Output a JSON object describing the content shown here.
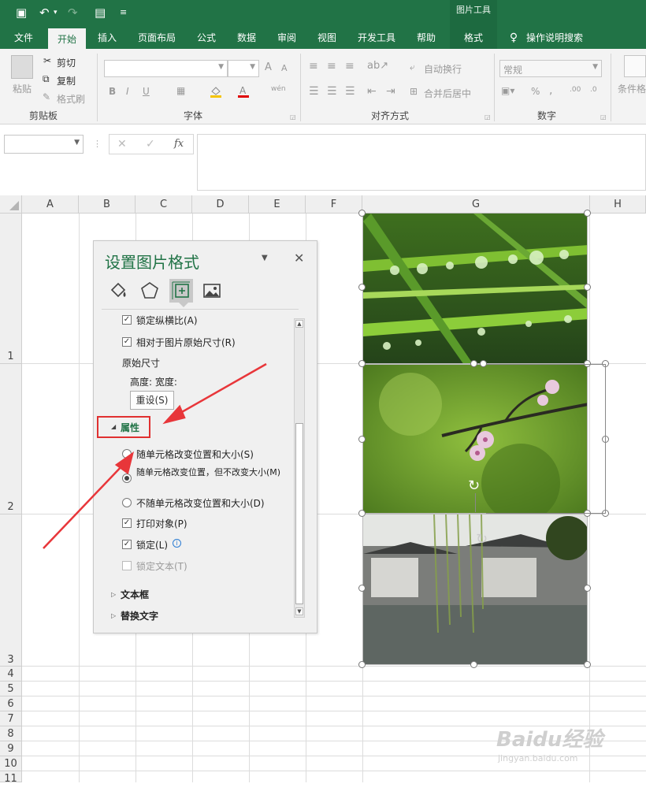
{
  "quick_access": {
    "save_icon": "save-icon",
    "undo_icon": "undo-icon",
    "redo_icon": "redo-icon",
    "form_icon": "form-icon",
    "customize_icon": "customize-icon"
  },
  "contextual_title": "图片工具",
  "tabs": [
    "文件",
    "开始",
    "插入",
    "页面布局",
    "公式",
    "数据",
    "审阅",
    "视图",
    "开发工具",
    "帮助",
    "格式"
  ],
  "tell_me": "操作说明搜索",
  "ribbon": {
    "clipboard": {
      "paste": "粘贴",
      "cut": "剪切",
      "copy": "复制",
      "format_painter": "格式刷",
      "label": "剪贴板"
    },
    "font": {
      "label": "字体",
      "bold": "B",
      "italic": "I",
      "underline": "U",
      "grow": "A",
      "shrink": "A",
      "wen": "wén"
    },
    "alignment": {
      "wrap": "自动换行",
      "merge": "合并后居中",
      "label": "对齐方式"
    },
    "number": {
      "format": "常规",
      "percent": "%",
      "comma": ",",
      "label": "数字"
    },
    "styles": {
      "conditional": "条件格"
    }
  },
  "formula_bar": {
    "fx": "fx",
    "cancel": "✕",
    "enter": "✓"
  },
  "columns": [
    "A",
    "B",
    "C",
    "D",
    "E",
    "F",
    "G",
    "H"
  ],
  "rows": [
    "1",
    "2",
    "3",
    "4",
    "5",
    "6",
    "7",
    "8",
    "9",
    "10",
    "11"
  ],
  "pane": {
    "title": "设置图片格式",
    "items": {
      "lock_ratio": "锁定纵横比(A)",
      "relative_original": "相对于图片原始尺寸(R)",
      "original_size": "原始尺寸",
      "height_width": "高度:   宽度:",
      "reset": "重设(S)",
      "properties": "属性",
      "opt1": "随单元格改变位置和大小(S)",
      "opt2": "随单元格改变位置，但不改变大小(M)",
      "opt3": "不随单元格改变位置和大小(D)",
      "print": "打印对象(P)",
      "locked": "锁定(L)",
      "lock_text": "锁定文本(T)",
      "textbox": "文本框",
      "alt_text": "替换文字"
    },
    "selected_option": "opt2"
  },
  "watermark": {
    "brand": "Baidu经验",
    "url": "jingyan.baidu.com"
  }
}
